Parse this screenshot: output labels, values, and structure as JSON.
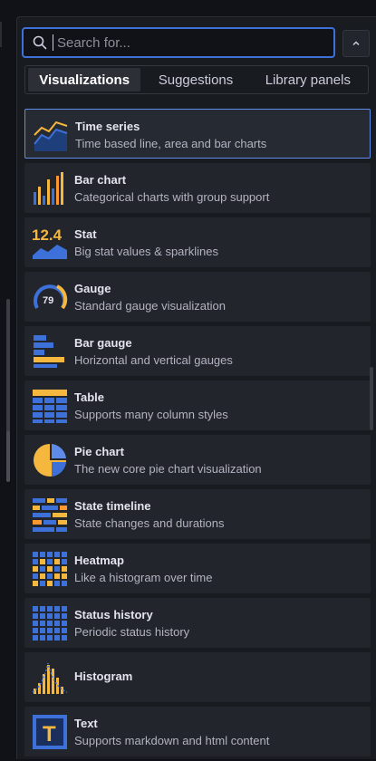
{
  "search": {
    "placeholder": "Search for..."
  },
  "tabs": [
    {
      "label": "Visualizations",
      "active": true
    },
    {
      "label": "Suggestions",
      "active": false
    },
    {
      "label": "Library panels",
      "active": false
    }
  ],
  "visualizations": [
    {
      "name": "Time series",
      "description": "Time based line, area and bar charts",
      "icon": "time-series-icon",
      "selected": true
    },
    {
      "name": "Bar chart",
      "description": "Categorical charts with group support",
      "icon": "bar-chart-icon"
    },
    {
      "name": "Stat",
      "description": "Big stat values & sparklines",
      "icon": "stat-icon",
      "icon_text": "12.4"
    },
    {
      "name": "Gauge",
      "description": "Standard gauge visualization",
      "icon": "gauge-icon",
      "icon_text": "79"
    },
    {
      "name": "Bar gauge",
      "description": "Horizontal and vertical gauges",
      "icon": "bar-gauge-icon"
    },
    {
      "name": "Table",
      "description": "Supports many column styles",
      "icon": "table-icon"
    },
    {
      "name": "Pie chart",
      "description": "The new core pie chart visualization",
      "icon": "pie-chart-icon"
    },
    {
      "name": "State timeline",
      "description": "State changes and durations",
      "icon": "state-timeline-icon"
    },
    {
      "name": "Heatmap",
      "description": "Like a histogram over time",
      "icon": "heatmap-icon"
    },
    {
      "name": "Status history",
      "description": "Periodic status history",
      "icon": "status-history-icon"
    },
    {
      "name": "Histogram",
      "description": "",
      "icon": "histogram-icon"
    },
    {
      "name": "Text",
      "description": "Supports markdown and html content",
      "icon": "text-icon",
      "icon_text": "T"
    }
  ],
  "colors": {
    "accent": "#3d71d9",
    "blue": "#3d71d9",
    "yellow": "#f5b73d",
    "orange": "#ff9830",
    "background": "#181b1f",
    "card": "#22252b"
  }
}
